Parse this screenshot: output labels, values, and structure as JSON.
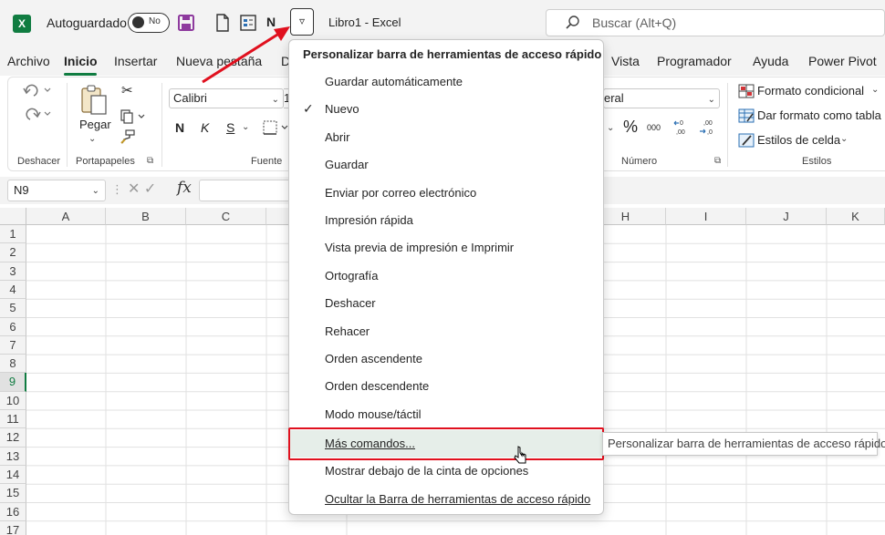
{
  "titlebar": {
    "app_logo": "X",
    "autosave_label": "Autoguardado",
    "autosave_state": "No",
    "document_title": "Libro1  -  Excel",
    "search_placeholder": "Buscar (Alt+Q)",
    "qat_letter": "N",
    "qat_dropdown_glyph": "▿"
  },
  "menubar": {
    "tabs": [
      "Archivo",
      "Inicio",
      "Insertar",
      "Nueva pestaña",
      "D",
      "Vista",
      "Programador",
      "Ayuda",
      "Power Pivot"
    ],
    "active_tab": "Inicio"
  },
  "ribbon": {
    "groups": {
      "undo": "Deshacer",
      "clipboard": "Portapapeles",
      "font": "Fuente",
      "number": "Número",
      "styles": "Estilos"
    },
    "paste_label": "Pegar",
    "font_name": "Calibri",
    "font_size": "1",
    "bold": "N",
    "italic": "K",
    "underline": "S",
    "number_format": "eral",
    "percent": "%",
    "thousands": "000",
    "conditional_format": "Formato condicional",
    "format_as_table": "Dar formato como tabla",
    "cell_styles": "Estilos de celda"
  },
  "formulabar": {
    "name_box": "N9",
    "fx": "fx"
  },
  "grid": {
    "columns": [
      "A",
      "B",
      "C",
      "H",
      "I",
      "J",
      "K"
    ],
    "rows": [
      "1",
      "2",
      "3",
      "4",
      "5",
      "6",
      "7",
      "8",
      "9",
      "10",
      "11",
      "12",
      "13",
      "14",
      "15",
      "16",
      "17"
    ],
    "selected_row": "9"
  },
  "qat_menu": {
    "header": "Personalizar barra de herramientas de acceso rápido",
    "items": [
      {
        "label": "Guardar automáticamente",
        "checked": false
      },
      {
        "label": "Nuevo",
        "checked": true
      },
      {
        "label": "Abrir",
        "checked": false
      },
      {
        "label": "Guardar",
        "checked": false
      },
      {
        "label": "Enviar por correo electrónico",
        "checked": false
      },
      {
        "label": "Impresión rápida",
        "checked": false
      },
      {
        "label": "Vista previa de impresión e Imprimir",
        "checked": false
      },
      {
        "label": "Ortografía",
        "checked": false
      },
      {
        "label": "Deshacer",
        "checked": false
      },
      {
        "label": "Rehacer",
        "checked": false
      },
      {
        "label": "Orden ascendente",
        "checked": false
      },
      {
        "label": "Orden descendente",
        "checked": false
      },
      {
        "label": "Modo mouse/táctil",
        "checked": false
      }
    ],
    "more_commands": "Más comandos...",
    "show_below": "Mostrar debajo de la cinta de opciones",
    "hide_qat": "Ocultar la Barra de herramientas de acceso rápido",
    "check_glyph": "✓"
  },
  "tooltip": "Personalizar barra de herramientas de acceso rápido",
  "colors": {
    "excel_green": "#107c41",
    "highlight_red": "#e0101e",
    "chrome_gray": "#f3f3f3"
  }
}
